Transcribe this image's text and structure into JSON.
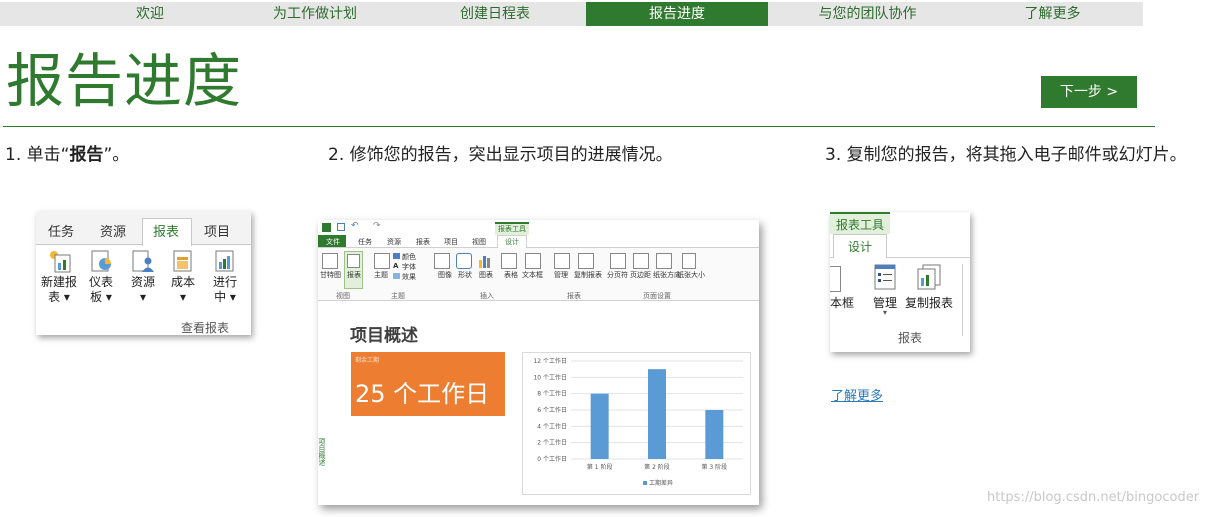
{
  "nav": {
    "tabs": [
      {
        "label": "欢迎",
        "active": false
      },
      {
        "label": "为工作做计划",
        "active": false
      },
      {
        "label": "创建日程表",
        "active": false
      },
      {
        "label": "报告进度",
        "active": true
      },
      {
        "label": "与您的团队协作",
        "active": false
      },
      {
        "label": "了解更多",
        "active": false
      }
    ]
  },
  "page": {
    "title": "报告进度",
    "next_button": "下一步 >"
  },
  "steps": {
    "s1_prefix": "1. 单击“",
    "s1_bold": "报告",
    "s1_suffix": "”。",
    "s2": "2. 修饰您的报告，突出显示项目的进展情况。",
    "s3": "3. 复制您的报告，将其拖入电子邮件或幻灯片。"
  },
  "card1": {
    "tabs": [
      "任务",
      "资源",
      "报表",
      "项目"
    ],
    "buttons": [
      {
        "l1": "新建报",
        "l2": "表 ▾"
      },
      {
        "l1": "仪表",
        "l2": "板 ▾"
      },
      {
        "l1": "资源",
        "l2": "▾"
      },
      {
        "l1": "成本",
        "l2": "▾"
      },
      {
        "l1": "进行",
        "l2": "中 ▾"
      }
    ],
    "group": "查看报表"
  },
  "card2": {
    "contextual_tab": "报表工具",
    "file_tab": "文件",
    "tabs": [
      "任务",
      "资源",
      "报表",
      "项目",
      "视图",
      "设计"
    ],
    "ribbon_buttons": [
      "甘特图",
      "报表",
      "主题",
      "颜色",
      "字体",
      "效果",
      "图像",
      "形状",
      "图表",
      "表格",
      "文本框",
      "管理",
      "复制报表",
      "分页符",
      "页边距",
      "纸张方向",
      "纸张大小"
    ],
    "groups": [
      "视图",
      "主题",
      "插入",
      "报表",
      "页面设置"
    ],
    "report_title": "项目概述",
    "tile_label": "剩余工期",
    "tile_value": "25 个工作日",
    "side_label": "项目概述"
  },
  "chart_data": {
    "type": "bar",
    "categories": [
      "第 1 阶段",
      "第 2 阶段",
      "第 3 阶段"
    ],
    "series": [
      {
        "name": "工期差异",
        "values": [
          8,
          11,
          6
        ]
      }
    ],
    "ylim": [
      0,
      12
    ],
    "yticks": [
      "0 个工作日",
      "2 个工作日",
      "4 个工作日",
      "6 个工作日",
      "8 个工作日",
      "10 个工作日",
      "12 个工作日"
    ],
    "bar_color": "#5b9bd5"
  },
  "card3": {
    "contextual_tab": "报表工具",
    "tab": "设计",
    "partial_button": "本框",
    "manage_button": "管理",
    "copy_button": "复制报表",
    "group": "报表"
  },
  "links": {
    "learn_more": "了解更多"
  },
  "watermark": "https://blog.csdn.net/bingocoder",
  "colors": {
    "accent_green": "#2f7a2f",
    "tile_orange": "#ed7d31",
    "link_blue": "#2a7ab8"
  }
}
